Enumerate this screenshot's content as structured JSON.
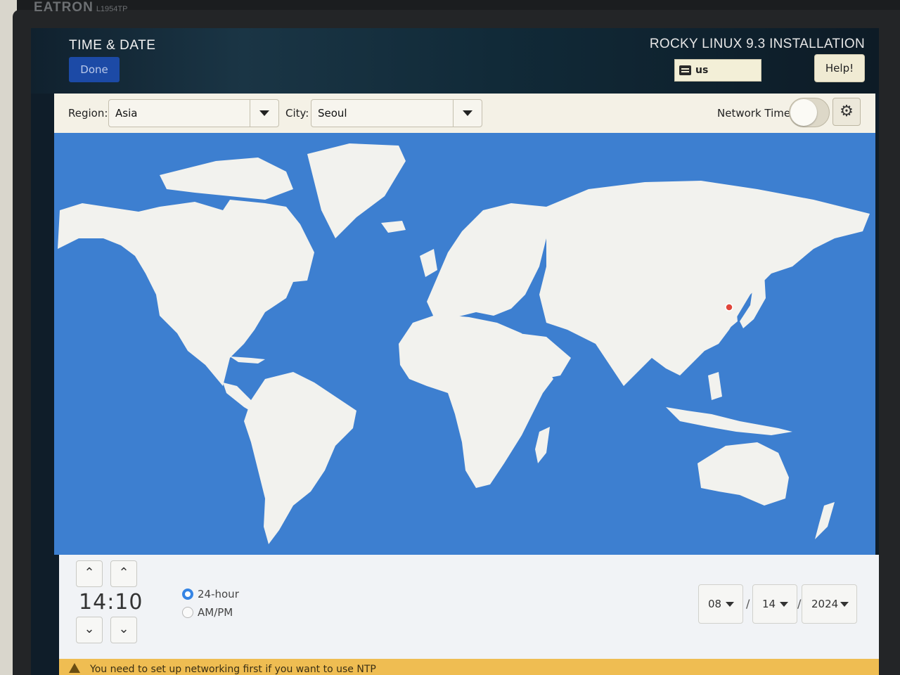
{
  "monitor": {
    "brand": "EATRON",
    "model": "L1954TP"
  },
  "header": {
    "title": "TIME & DATE",
    "done_label": "Done",
    "product": "ROCKY LINUX 9.3 INSTALLATION",
    "keyboard_layout": "us",
    "keyboard_icon": "keyboard-icon",
    "help_label": "Help!"
  },
  "toolbar": {
    "region_label": "Region:",
    "region_value": "Asia",
    "city_label": "City:",
    "city_value": "Seoul",
    "network_time_label": "Network Time",
    "network_time_on": false,
    "settings_icon": "gear-icon"
  },
  "map": {
    "selected_city": "Seoul",
    "marker_color": "#e0463a",
    "ocean_color": "#3d7fd0",
    "land_color": "#f2f2ee"
  },
  "time": {
    "hours": "14",
    "separator": ":",
    "minutes": "10",
    "up_glyph": "⌃",
    "down_glyph": "⌄"
  },
  "format": {
    "options": [
      "24-hour",
      "AM/PM"
    ],
    "selected": "24-hour"
  },
  "date": {
    "month": "08",
    "day": "14",
    "year": "2024",
    "separator": "/"
  },
  "warning": {
    "icon": "warning-icon",
    "text": "You need to set up networking first if you want to use NTP"
  }
}
